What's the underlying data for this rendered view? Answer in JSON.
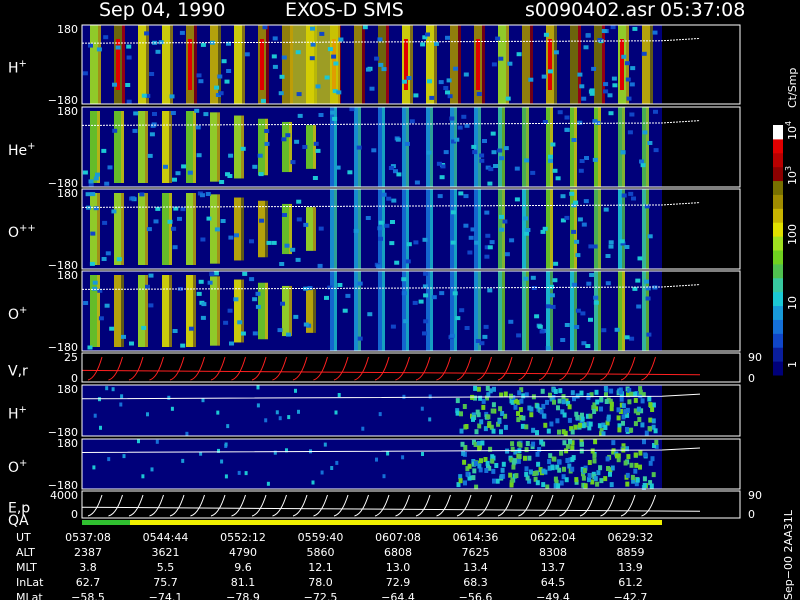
{
  "header": {
    "date": "Sep 04, 1990",
    "instrument": "EXOS-D SMS",
    "file": "s0090402.asr",
    "time": "05:37:08"
  },
  "colorbar": {
    "title": "Ct/Smp",
    "labels": [
      "1",
      "10",
      "100",
      "10",
      "10"
    ],
    "exponents": [
      "3",
      "4"
    ],
    "colors": [
      "#00007a",
      "#0a1e9c",
      "#1046c8",
      "#1570d8",
      "#199ad8",
      "#1cc8d4",
      "#38c8a0",
      "#50c050",
      "#70d020",
      "#a0e020",
      "#e0e000",
      "#c8b400",
      "#a08c00",
      "#787000",
      "#8c0000",
      "#b80000",
      "#e00000",
      "#ffffff"
    ]
  },
  "panels": [
    {
      "id": "h-plus",
      "label": "H",
      "sup": "+",
      "ymax": "180",
      "ymin": "−180"
    },
    {
      "id": "he-plus",
      "label": "He",
      "sup": "+",
      "ymax": "180",
      "ymin": "−180"
    },
    {
      "id": "o-plusplus",
      "label": "O",
      "sup": "++",
      "ymax": "180",
      "ymin": "−180"
    },
    {
      "id": "o-plus",
      "label": "O",
      "sup": "+",
      "ymax": "180",
      "ymin": "−180"
    },
    {
      "id": "vr",
      "label": "V,r",
      "ymax": "25",
      "ymin": "0",
      "right_top": "90",
      "right_bottom": "0"
    },
    {
      "id": "h-plus-2",
      "label": "H",
      "sup": "+",
      "ymax": "180",
      "ymin": "−180"
    },
    {
      "id": "o-plus-2",
      "label": "O",
      "sup": "+",
      "ymax": "180",
      "ymin": "−180"
    },
    {
      "id": "ep",
      "label": "E,p",
      "ymax": "4000",
      "ymin": "0",
      "right_top": "90",
      "right_bottom": "0"
    }
  ],
  "qa": {
    "label": "QA"
  },
  "side_label": "Sep−00 2AA31L",
  "table": {
    "rows": [
      {
        "label": "UT",
        "values": [
          "0537:08",
          "0544:44",
          "0552:12",
          "0559:40",
          "0607:08",
          "0614:36",
          "0622:04",
          "0629:32"
        ]
      },
      {
        "label": "ALT",
        "values": [
          "2387",
          "3621",
          "4790",
          "5860",
          "6808",
          "7625",
          "8308",
          "8859"
        ]
      },
      {
        "label": "MLT",
        "values": [
          "3.8",
          "5.5",
          "9.6",
          "12.1",
          "13.0",
          "13.4",
          "13.7",
          "13.9"
        ]
      },
      {
        "label": "InLat",
        "values": [
          "62.7",
          "75.7",
          "81.1",
          "78.0",
          "72.9",
          "68.3",
          "64.5",
          "61.2"
        ]
      },
      {
        "label": "MLat",
        "values": [
          "−58.5",
          "−74.1",
          "−78.9",
          "−72.5",
          "−64.4",
          "−56.6",
          "−49.4",
          "−42.7"
        ]
      }
    ]
  },
  "chart_data": {
    "type": "heatmap",
    "title": "Sep 04, 1990  EXOS-D SMS",
    "x": [
      "0537:08",
      "0544:44",
      "0552:12",
      "0559:40",
      "0607:08",
      "0614:36",
      "0622:04",
      "0629:32"
    ],
    "series": [
      {
        "name": "H+",
        "ylim": [
          -180,
          180
        ]
      },
      {
        "name": "He+",
        "ylim": [
          -180,
          180
        ]
      },
      {
        "name": "O++",
        "ylim": [
          -180,
          180
        ]
      },
      {
        "name": "O+",
        "ylim": [
          -180,
          180
        ]
      },
      {
        "name": "V,r",
        "ylim": [
          0,
          25
        ]
      },
      {
        "name": "H+",
        "ylim": [
          -180,
          180
        ]
      },
      {
        "name": "O+",
        "ylim": [
          -180,
          180
        ]
      },
      {
        "name": "E,p",
        "ylim": [
          0,
          4000
        ]
      }
    ],
    "colorbar_range": [
      1,
      10000
    ],
    "colorbar_scale": "log",
    "colorbar_unit": "Ct/Smp"
  }
}
